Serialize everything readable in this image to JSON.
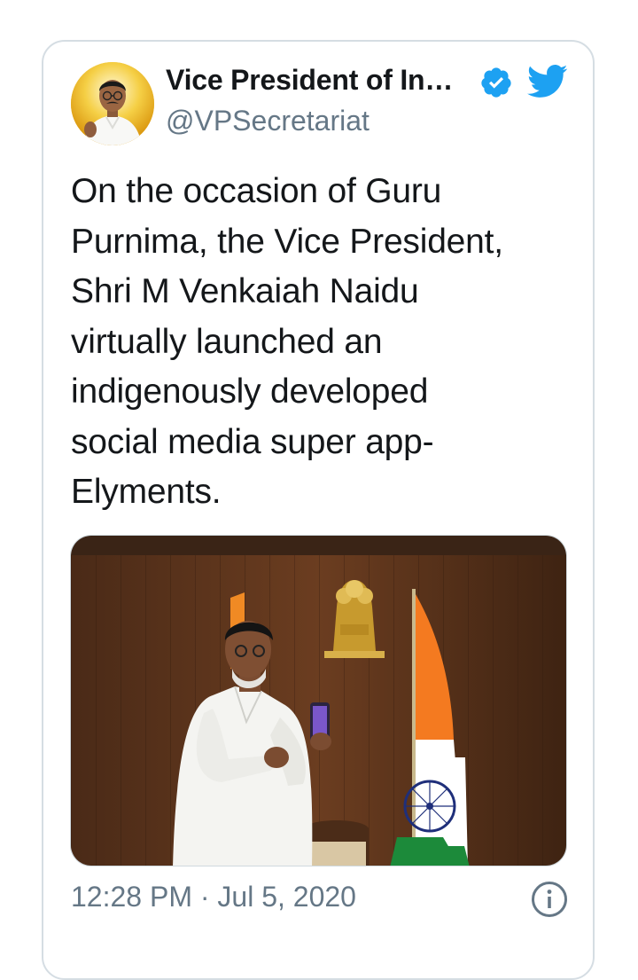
{
  "tweet": {
    "author_name": "Vice President of In…",
    "handle": "@VPSecretariat",
    "text": "On the occasion of Guru\nPurnima, the Vice President,\nShri M Venkaiah Naidu\nvirtually launched an\nindigenously developed\nsocial media super app-\nElyments.",
    "timestamp": "12:28 PM · Jul 5, 2020",
    "verified": true
  },
  "icons": {
    "avatar": "profile-avatar",
    "verified": "verified-badge-icon",
    "brand": "twitter-bird-icon",
    "info": "info-icon"
  },
  "colors": {
    "brand": "#1da1f2",
    "text": "#14171a",
    "muted": "#657786",
    "border": "#d5dde3"
  }
}
